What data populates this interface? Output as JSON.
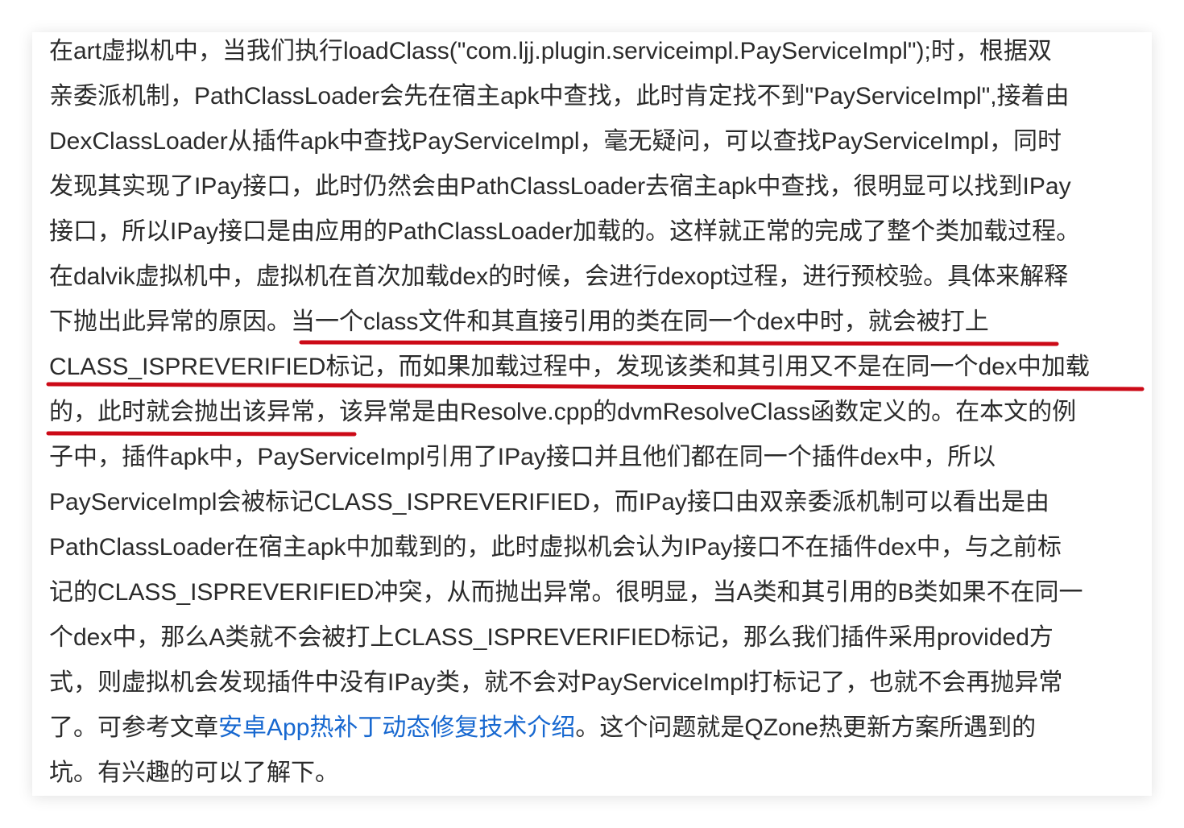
{
  "article": {
    "lines": [
      "在art虚拟机中，当我们执行loadClass(\"com.ljj.plugin.serviceimpl.PayServiceImpl\");时，根据双",
      "亲委派机制，PathClassLoader会先在宿主apk中查找，此时肯定找不到\"PayServiceImpl\",接着由",
      "DexClassLoader从插件apk中查找PayServiceImpl，毫无疑问，可以查找PayServiceImpl，同时",
      "发现其实现了IPay接口，此时仍然会由PathClassLoader去宿主apk中查找，很明显可以找到IPay",
      "接口，所以IPay接口是由应用的PathClassLoader加载的。这样就正常的完成了整个类加载过程。",
      "在dalvik虚拟机中，虚拟机在首次加载dex的时候，会进行dexopt过程，进行预校验。具体来解释",
      "下抛出此异常的原因。当一个class文件和其直接引用的类在同一个dex中时，就会被打上",
      "CLASS_ISPREVERIFIED标记，而如果加载过程中，发现该类和其引用又不是在同一个dex中加载",
      "的，此时就会抛出该异常，该异常是由Resolve.cpp的dvmResolveClass函数定义的。在本文的例",
      "子中，插件apk中，PayServiceImpl引用了IPay接口并且他们都在同一个插件dex中，所以",
      "PayServiceImpl会被标记CLASS_ISPREVERIFIED，而IPay接口由双亲委派机制可以看出是由",
      "PathClassLoader在宿主apk中加载到的，此时虚拟机会认为IPay接口不在插件dex中，与之前标",
      "记的CLASS_ISPREVERIFIED冲突，从而抛出异常。很明显，当A类和其引用的B类如果不在同一",
      "个dex中，那么A类就不会被打上CLASS_ISPREVERIFIED标记，那么我们插件采用provided方",
      "式，则虚拟机会发现插件中没有IPay类，就不会对PayServiceImpl打标记了，也就不会再抛异常"
    ],
    "link_line": {
      "before": "了。可参考文章",
      "link": "安卓App热补丁动态修复技术介绍",
      "after": "。这个问题就是QZone热更新方案所遇到的"
    },
    "last_line": "坑。有兴趣的可以了解下。"
  },
  "colors": {
    "text": "#2b2b2b",
    "link": "#1768d0",
    "underline_mark": "#cc0a17"
  }
}
